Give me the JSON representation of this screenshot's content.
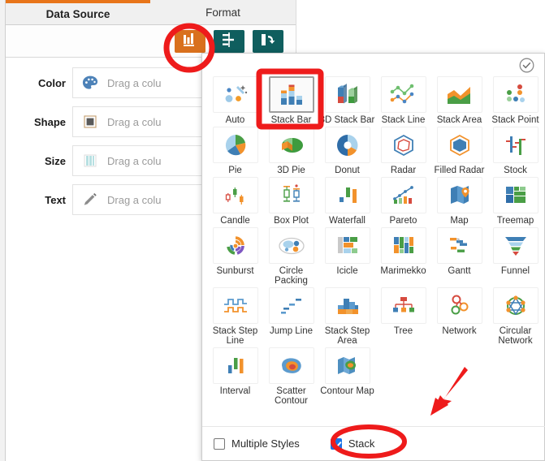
{
  "window": {
    "tabs": [
      {
        "label": "Data Source",
        "active": true
      },
      {
        "label": "Format",
        "active": false
      }
    ],
    "accent_color": "#e8751a"
  },
  "toolbar": {
    "buttons": [
      {
        "name": "chart-type-button",
        "icon": "bar-chart-icon",
        "active": true,
        "color": "#d9701d"
      },
      {
        "name": "axis-settings-button",
        "icon": "axis-icon",
        "active": false,
        "color": "#0f5e5e"
      },
      {
        "name": "swap-axis-button",
        "icon": "swap-icon",
        "active": false,
        "color": "#0f5e5e"
      }
    ]
  },
  "properties": {
    "rows": [
      {
        "label": "Color",
        "icon": "palette-icon",
        "placeholder": "Drag a colu"
      },
      {
        "label": "Shape",
        "icon": "square-shape-icon",
        "placeholder": "Drag a colu"
      },
      {
        "label": "Size",
        "icon": "size-bars-icon",
        "placeholder": "Drag a colu"
      },
      {
        "label": "Text",
        "icon": "pencil-icon",
        "placeholder": "Drag a colu"
      }
    ]
  },
  "popup": {
    "confirm_icon": "check-circle-icon",
    "chart_types": [
      [
        {
          "label": "Auto",
          "icon": "auto-icon",
          "selected": false
        },
        {
          "label": "Stack Bar",
          "icon": "stack-bar-icon",
          "selected": true
        },
        {
          "label": "3D Stack Bar",
          "icon": "3d-stack-bar-icon",
          "selected": false
        },
        {
          "label": "Stack Line",
          "icon": "stack-line-icon",
          "selected": false
        },
        {
          "label": "Stack Area",
          "icon": "stack-area-icon",
          "selected": false
        },
        {
          "label": "Stack Point",
          "icon": "stack-point-icon",
          "selected": false
        }
      ],
      [
        {
          "label": "Pie",
          "icon": "pie-icon",
          "selected": false
        },
        {
          "label": "3D Pie",
          "icon": "3d-pie-icon",
          "selected": false
        },
        {
          "label": "Donut",
          "icon": "donut-icon",
          "selected": false
        },
        {
          "label": "Radar",
          "icon": "radar-icon",
          "selected": false
        },
        {
          "label": "Filled Radar",
          "icon": "filled-radar-icon",
          "selected": false
        },
        {
          "label": "Stock",
          "icon": "stock-icon",
          "selected": false
        }
      ],
      [
        {
          "label": "Candle",
          "icon": "candle-icon",
          "selected": false
        },
        {
          "label": "Box Plot",
          "icon": "box-plot-icon",
          "selected": false
        },
        {
          "label": "Waterfall",
          "icon": "waterfall-icon",
          "selected": false
        },
        {
          "label": "Pareto",
          "icon": "pareto-icon",
          "selected": false
        },
        {
          "label": "Map",
          "icon": "map-icon",
          "selected": false
        },
        {
          "label": "Treemap",
          "icon": "treemap-icon",
          "selected": false
        }
      ],
      [
        {
          "label": "Sunburst",
          "icon": "sunburst-icon",
          "selected": false
        },
        {
          "label": "Circle Packing",
          "icon": "circle-packing-icon",
          "selected": false
        },
        {
          "label": "Icicle",
          "icon": "icicle-icon",
          "selected": false
        },
        {
          "label": "Marimekko",
          "icon": "marimekko-icon",
          "selected": false
        },
        {
          "label": "Gantt",
          "icon": "gantt-icon",
          "selected": false
        },
        {
          "label": "Funnel",
          "icon": "funnel-icon",
          "selected": false
        }
      ],
      [
        {
          "label": "Stack Step Line",
          "icon": "stack-step-line-icon",
          "selected": false
        },
        {
          "label": "Jump Line",
          "icon": "jump-line-icon",
          "selected": false
        },
        {
          "label": "Stack Step Area",
          "icon": "stack-step-area-icon",
          "selected": false
        },
        {
          "label": "Tree",
          "icon": "tree-icon",
          "selected": false
        },
        {
          "label": "Network",
          "icon": "network-icon",
          "selected": false
        },
        {
          "label": "Circular Network",
          "icon": "circular-network-icon",
          "selected": false
        }
      ],
      [
        {
          "label": "Interval",
          "icon": "interval-icon",
          "selected": false
        },
        {
          "label": "Scatter Contour",
          "icon": "scatter-contour-icon",
          "selected": false
        },
        {
          "label": "Contour Map",
          "icon": "contour-map-icon",
          "selected": false
        }
      ]
    ],
    "options": [
      {
        "label": "Multiple Styles",
        "checked": false
      },
      {
        "label": "Stack",
        "checked": true
      }
    ]
  },
  "annotations": {
    "color": "#ee1b1b",
    "shapes": [
      {
        "name": "circle-highlight-chart-type-button"
      },
      {
        "name": "rect-highlight-stack-bar"
      },
      {
        "name": "ellipse-highlight-stack-checkbox"
      },
      {
        "name": "arrow-pointing-stack-checkbox"
      }
    ]
  }
}
